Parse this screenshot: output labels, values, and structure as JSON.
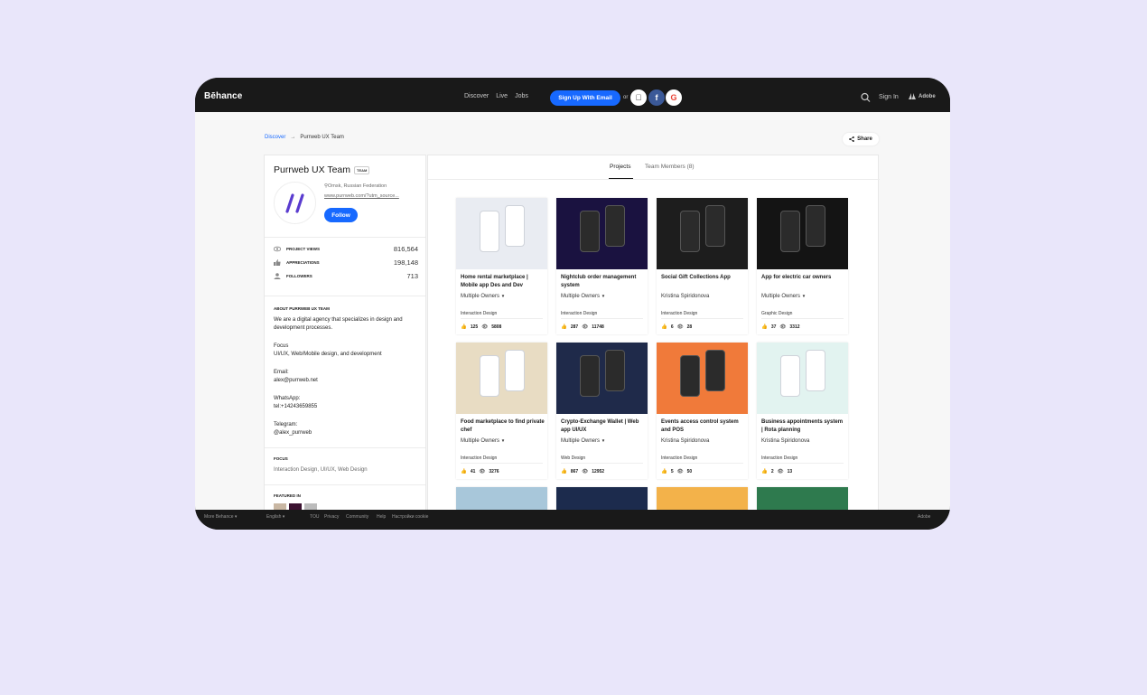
{
  "topbar": {
    "logo": "Bēhance",
    "nav": [
      "Discover",
      "Live",
      "Jobs"
    ],
    "signup": "Sign Up With Email",
    "or": "or",
    "signin": "Sign In",
    "adobe": "Adobe"
  },
  "breadcrumb": {
    "discover": "Discover",
    "arrow": "→",
    "current": "Purrweb UX Team"
  },
  "share": "Share",
  "profile": {
    "name": "Purrweb UX Team",
    "badge": "TEAM",
    "location": "Omsk, Russian Federation",
    "url": "www.purrweb.com/?utm_source...",
    "follow": "Follow",
    "stats": [
      {
        "label": "PROJECT VIEWS",
        "value": "816,564",
        "icon": "eye-icon"
      },
      {
        "label": "APPRECIATIONS",
        "value": "198,148",
        "icon": "thumbs-up-icon"
      },
      {
        "label": "FOLLOWERS",
        "value": "713",
        "icon": "person-icon"
      }
    ],
    "about_heading": "ABOUT PURRWEB UX TEAM",
    "about_text": "We are a digital agency that specializes in design and development processes.",
    "focus_label": "Focus",
    "focus_value": "UI/UX, Web/Mobile design, and development",
    "email_label": "Email:",
    "email_value": "alex@purrweb.net",
    "whatsapp_label": "WhatsApp:",
    "whatsapp_value": "tel:+14243659855",
    "telegram_label": "Telegram:",
    "telegram_value": "@alex_purrweb",
    "focus_heading": "FOCUS",
    "focus_tags": "Interaction Design, UI/UX, Web Design",
    "featured_heading": "FEATURED IN"
  },
  "tabs": {
    "projects": "Projects",
    "members": "Team Members (8)"
  },
  "projects": [
    {
      "title": "Home rental marketplace | Mobile app Des and Dev",
      "owner": "Multiple Owners",
      "dropdown": true,
      "category": "Interaction Design",
      "likes": "125",
      "views": "5808",
      "bg": "#e9ecf2"
    },
    {
      "title": "Nightclub order management system",
      "owner": "Multiple Owners",
      "dropdown": true,
      "category": "Interaction Design",
      "likes": "287",
      "views": "11748",
      "bg": "#1a1240"
    },
    {
      "title": "Social Gift Collections App",
      "owner": "Kristina Spiridonova",
      "dropdown": false,
      "category": "Interaction Design",
      "likes": "6",
      "views": "28",
      "bg": "#1d1d1d"
    },
    {
      "title": "App for electric car owners",
      "owner": "Multiple Owners",
      "dropdown": true,
      "category": "Graphic Design",
      "likes": "37",
      "views": "3312",
      "bg": "#141414"
    },
    {
      "title": "Food marketplace to find private chef",
      "owner": "Multiple Owners",
      "dropdown": true,
      "category": "Interaction Design",
      "likes": "41",
      "views": "3276",
      "bg": "#e8dcc3"
    },
    {
      "title": "Crypto-Exchange Wallet | Web app UI/UX",
      "owner": "Multiple Owners",
      "dropdown": true,
      "category": "Web Design",
      "likes": "867",
      "views": "12952",
      "bg": "#1f2a4a"
    },
    {
      "title": "Events access control system and POS",
      "owner": "Kristina Spiridonova",
      "dropdown": false,
      "category": "Interaction Design",
      "likes": "5",
      "views": "50",
      "bg": "#f07a3a"
    },
    {
      "title": "Business appointments system | Rota planning",
      "owner": "Kristina Spiridonova",
      "dropdown": false,
      "category": "Interaction Design",
      "likes": "2",
      "views": "13",
      "bg": "#e2f3f0"
    }
  ],
  "partial_cards": [
    {
      "bg": "#a8c7da"
    },
    {
      "bg": "#1c2b4d"
    },
    {
      "bg": "#f3b24a"
    },
    {
      "bg": "#2e7a4e"
    }
  ],
  "footer": {
    "more": "More Behance ▾",
    "language": "English ▾",
    "links": [
      "TOU",
      "Privacy",
      "Community",
      "Help",
      "Настройки cookie"
    ],
    "adobe": "Adobe"
  },
  "colors": {
    "accent": "#1769ff",
    "dark": "#191919",
    "background": "#e9e6fa"
  }
}
